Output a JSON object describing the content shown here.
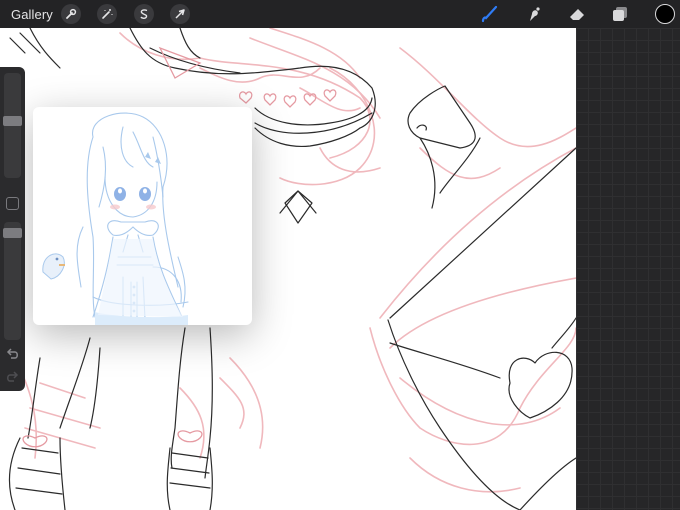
{
  "toolbar": {
    "gallery_label": "Gallery",
    "left_tools": [
      "wrench-icon",
      "magic-wand-icon",
      "selection-icon",
      "transform-arrow-icon"
    ],
    "right_tools": [
      "brush-icon",
      "smudge-icon",
      "eraser-icon",
      "layers-icon"
    ],
    "active_tool": "brush",
    "current_color": "#000000",
    "accent": "#2f7cf6"
  },
  "sidebar": {
    "brush_size_level": 0.55,
    "opacity_level": 0.94,
    "buttons": [
      "modify-button",
      "undo-icon",
      "redo-icon"
    ]
  },
  "reference_window": {
    "visible": true
  },
  "colors": {
    "canvas": "#ffffff",
    "toolbar": "#232325",
    "sketch_pink": "#f0b8bd",
    "line_art": "#2b2b2b",
    "reference_blue": "#a9c9ec"
  }
}
